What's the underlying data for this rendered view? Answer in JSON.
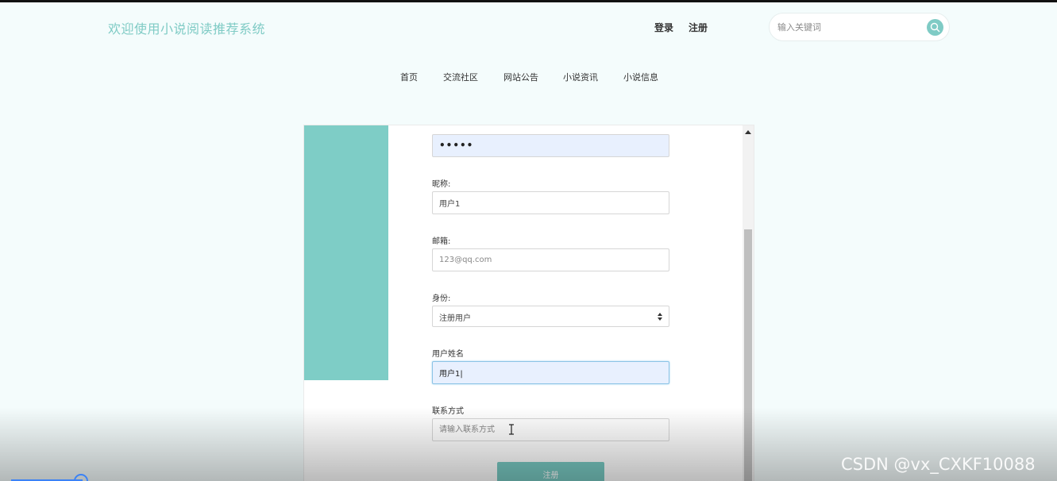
{
  "header": {
    "site_title": "欢迎使用小说阅读推荐系统",
    "login_label": "登录",
    "register_label": "注册",
    "search_placeholder": "输入关键词"
  },
  "nav": {
    "items": [
      "首页",
      "交流社区",
      "网站公告",
      "小说资讯",
      "小说信息"
    ]
  },
  "form": {
    "password_value": "•••••",
    "nickname_label": "昵称:",
    "nickname_value": "用户1",
    "email_label": "邮箱:",
    "email_placeholder": "123@qq.com",
    "role_label": "身份:",
    "role_selected": "注册用户",
    "username_label": "用户姓名",
    "username_value": "用户1|",
    "contact_label": "联系方式",
    "contact_placeholder": "请输入联系方式",
    "submit_label": "注册"
  },
  "video": {
    "progress": 0.07
  },
  "watermark": "CSDN @vx_CXKF10088",
  "colors": {
    "accent": "#7fcbc5",
    "autofill_bg": "#e8f0fe"
  }
}
